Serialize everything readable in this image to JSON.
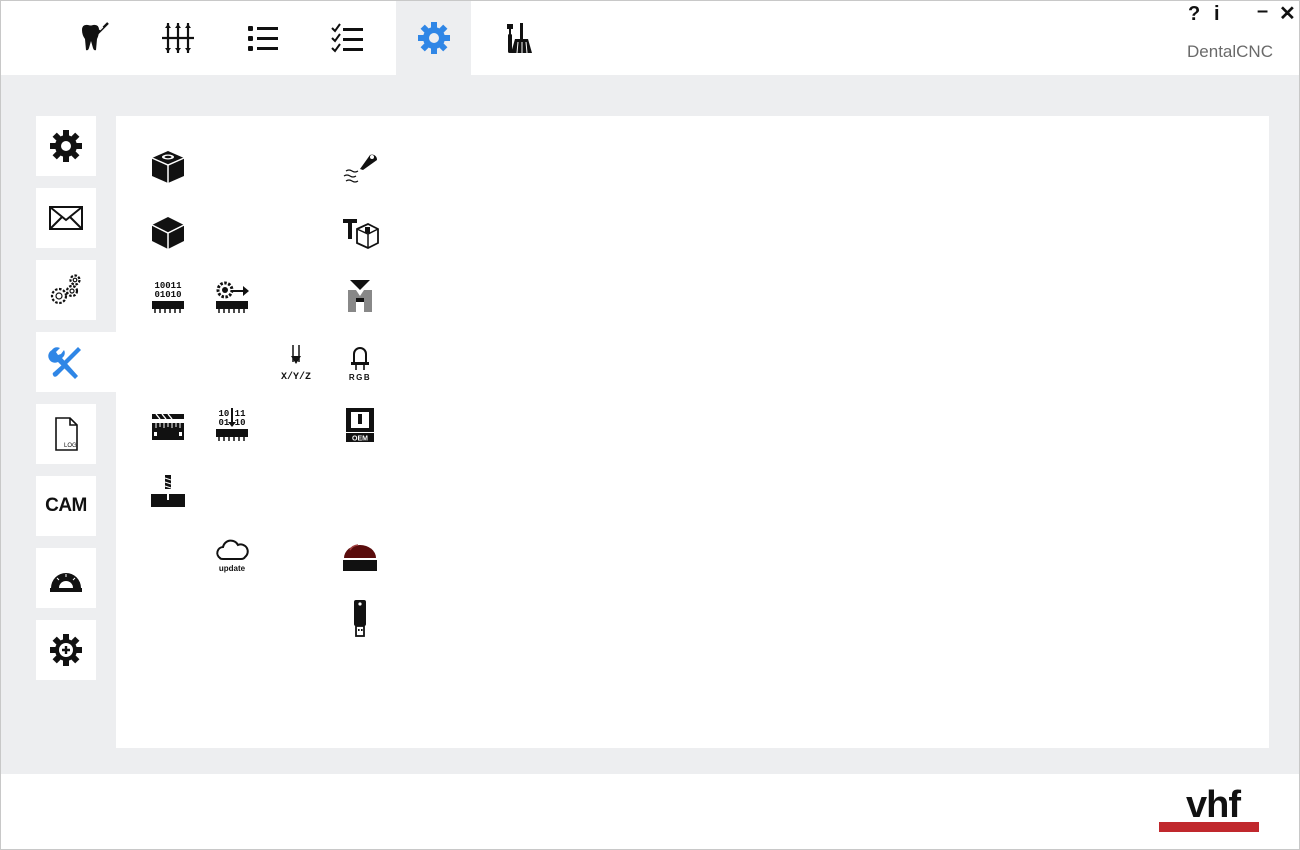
{
  "window": {
    "app_title": "DentalCNC",
    "help_label": "?",
    "info_label": "i",
    "minimize_label": "–",
    "close_label": "✕"
  },
  "accent_color": "#2f86e6",
  "selection_color": "#e8850f",
  "toolbar": {
    "tabs": [
      {
        "icon": "tooth-tool-icon",
        "active": false
      },
      {
        "icon": "sliders-icon",
        "active": false
      },
      {
        "icon": "list-icon",
        "active": false
      },
      {
        "icon": "checklist-icon",
        "active": false
      },
      {
        "icon": "gear-icon",
        "active": true
      },
      {
        "icon": "tools-broom-icon",
        "active": false
      }
    ]
  },
  "sidebar": {
    "items": [
      {
        "icon": "gear-icon"
      },
      {
        "icon": "envelope-icon"
      },
      {
        "icon": "multi-gear-icon"
      },
      {
        "icon": "wrench-screwdriver-icon",
        "active": true
      },
      {
        "icon": "log-file-icon",
        "label": "LOG"
      },
      {
        "icon": "cam-icon",
        "label": "CAM"
      },
      {
        "icon": "protractor-icon"
      },
      {
        "icon": "gear-plus-icon"
      }
    ]
  },
  "tools": {
    "xyz_label": "X/Y/Z",
    "rgb_label": "RGB",
    "oem_label": "OEM",
    "update_label": "update",
    "binary_label_1": "10011",
    "binary_label_2": "01010",
    "binary_label_3": "10 11",
    "binary_label_4": "01 10",
    "log_label": "LOG"
  },
  "footer": {
    "logo_text": "vhf"
  }
}
